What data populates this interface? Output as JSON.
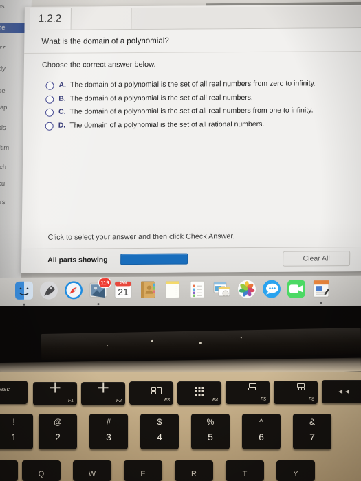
{
  "lms_sidebar": {
    "items": [
      {
        "label": "urs",
        "active": false
      },
      {
        "label": "me",
        "active": true
      },
      {
        "label": "uizz",
        "active": false
      },
      {
        "label": "tudy",
        "active": false
      },
      {
        "label": "rade",
        "active": false
      },
      {
        "label": "Chap",
        "active": false
      },
      {
        "label": "Tools",
        "active": false
      },
      {
        "label": "Multim",
        "active": false
      },
      {
        "label": "Purch",
        "active": false
      },
      {
        "label": "Discu",
        "active": false
      },
      {
        "label": "Cours",
        "active": false
      }
    ]
  },
  "exercise": {
    "tab_label": "1.2.2",
    "question": "What is the domain of a polynomial?",
    "instruction": "Choose the correct answer below.",
    "choices": [
      {
        "letter": "A.",
        "text": "The domain of a polynomial is the set of all real numbers from zero to infinity."
      },
      {
        "letter": "B.",
        "text": "The domain of a polynomial is the set of all real numbers."
      },
      {
        "letter": "C.",
        "text": "The domain of a polynomial is the set of all real numbers from one to infinity."
      },
      {
        "letter": "D.",
        "text": "The domain of a polynomial is the set of all rational numbers."
      }
    ],
    "hint": "Click to select your answer and then click Check Answer.",
    "all_parts_showing": "All parts showing",
    "check_answer_label": "",
    "clear_all_label": "Clear All",
    "accent_blue": "#1a72c4",
    "radio_blue": "#3b3f8c"
  },
  "dock": {
    "icons": [
      {
        "name": "finder-icon",
        "badge": "",
        "running": true
      },
      {
        "name": "launchpad-icon",
        "badge": "",
        "running": false
      },
      {
        "name": "safari-icon",
        "badge": "",
        "running": false
      },
      {
        "name": "mail-icon",
        "badge": "119",
        "running": true
      },
      {
        "name": "calendar-icon",
        "badge": "",
        "month": "JAN",
        "day": "21",
        "running": false
      },
      {
        "name": "contacts-icon",
        "badge": "",
        "running": false
      },
      {
        "name": "notes-icon",
        "badge": "",
        "running": false
      },
      {
        "name": "reminders-icon",
        "badge": "",
        "running": false
      },
      {
        "name": "news-icon",
        "badge": "",
        "running": false
      },
      {
        "name": "photos-icon",
        "badge": "",
        "running": false
      },
      {
        "name": "messages-icon",
        "badge": "",
        "running": false
      },
      {
        "name": "facetime-icon",
        "badge": "",
        "running": false
      },
      {
        "name": "pages-icon",
        "badge": "",
        "running": true
      }
    ]
  },
  "keyboard": {
    "function_row": [
      {
        "key": "esc",
        "label": "esc",
        "fnum": "",
        "glyph": "escape"
      },
      {
        "key": "f1",
        "label": "",
        "fnum": "F1",
        "glyph": "brightness-down"
      },
      {
        "key": "f2",
        "label": "",
        "fnum": "F2",
        "glyph": "brightness-up"
      },
      {
        "key": "f3",
        "label": "",
        "fnum": "F3",
        "glyph": "mission-control"
      },
      {
        "key": "f4",
        "label": "",
        "fnum": "F4",
        "glyph": "launchpad"
      },
      {
        "key": "f5",
        "label": "",
        "fnum": "F5",
        "glyph": "keyboard-backlight-down"
      },
      {
        "key": "f6",
        "label": "",
        "fnum": "F6",
        "glyph": "keyboard-backlight-up"
      },
      {
        "key": "f7",
        "label": "",
        "fnum": "",
        "glyph": "rewind"
      }
    ],
    "number_row": [
      {
        "sym": "!",
        "dig": "1"
      },
      {
        "sym": "@",
        "dig": "2"
      },
      {
        "sym": "#",
        "dig": "3"
      },
      {
        "sym": "$",
        "dig": "4"
      },
      {
        "sym": "%",
        "dig": "5"
      },
      {
        "sym": "^",
        "dig": "6"
      },
      {
        "sym": "&",
        "dig": "7"
      }
    ],
    "letter_row": [
      {
        "letter": ""
      },
      {
        "letter": "Q"
      },
      {
        "letter": "W"
      },
      {
        "letter": "E"
      },
      {
        "letter": "R"
      },
      {
        "letter": "T"
      },
      {
        "letter": "Y"
      }
    ]
  }
}
